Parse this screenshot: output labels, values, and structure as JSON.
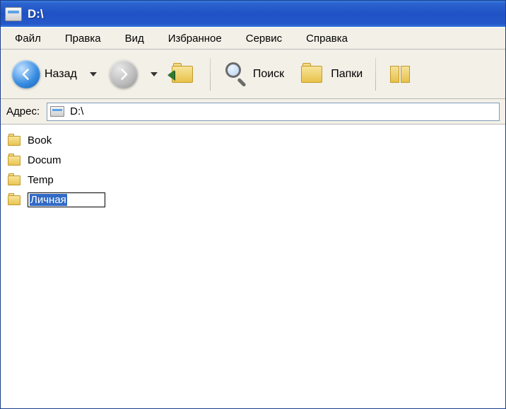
{
  "window": {
    "title": "D:\\"
  },
  "menu": {
    "file": "Файл",
    "edit": "Правка",
    "view": "Вид",
    "favorites": "Избранное",
    "tools": "Сервис",
    "help": "Справка"
  },
  "toolbar": {
    "back": "Назад",
    "search": "Поиск",
    "folders": "Папки"
  },
  "address": {
    "label": "Адрес:",
    "value": "D:\\"
  },
  "folders": [
    {
      "name": "Book",
      "editing": false
    },
    {
      "name": "Docum",
      "editing": false
    },
    {
      "name": "Temp",
      "editing": false
    },
    {
      "name": "Личная",
      "editing": true
    }
  ]
}
